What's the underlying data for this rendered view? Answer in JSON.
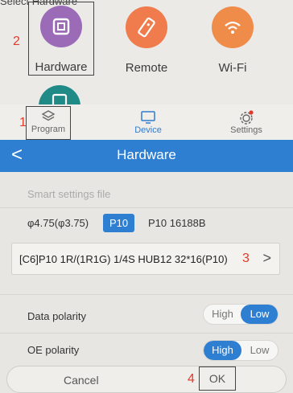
{
  "top_caption": "Select Hardware",
  "apps": [
    {
      "label": "Hardware",
      "icon": "hardware-icon",
      "color": "#9b6bb8"
    },
    {
      "label": "Remote",
      "icon": "remote-icon",
      "color": "#f07b4c"
    },
    {
      "label": "Wi-Fi",
      "icon": "wifi-icon",
      "color": "#f08c4a"
    }
  ],
  "annotations": {
    "step1": "1",
    "step2": "2",
    "step3": "3",
    "step4": "4",
    "color": "#e23b2c"
  },
  "nav": {
    "program": "Program",
    "device": "Device",
    "settings": "Settings"
  },
  "header": {
    "title": "Hardware",
    "back": "<",
    "color": "#2e7fd2"
  },
  "smart_settings_hint": "Smart settings file",
  "chips": {
    "option_a": "φ4.75(φ3.75)",
    "option_selected": "P10",
    "option_c": "P10 16188B"
  },
  "module_select": {
    "value": "[C6]P10 1R/(1R1G) 1/4S HUB12 32*16(P10)",
    "arrow": ">"
  },
  "data_polarity": {
    "label": "Data polarity",
    "high": "High",
    "low": "Low",
    "selected": "Low"
  },
  "oe_polarity": {
    "label": "OE polarity",
    "high": "High",
    "low": "Low",
    "selected": "High"
  },
  "buttons": {
    "cancel": "Cancel",
    "ok": "OK"
  }
}
